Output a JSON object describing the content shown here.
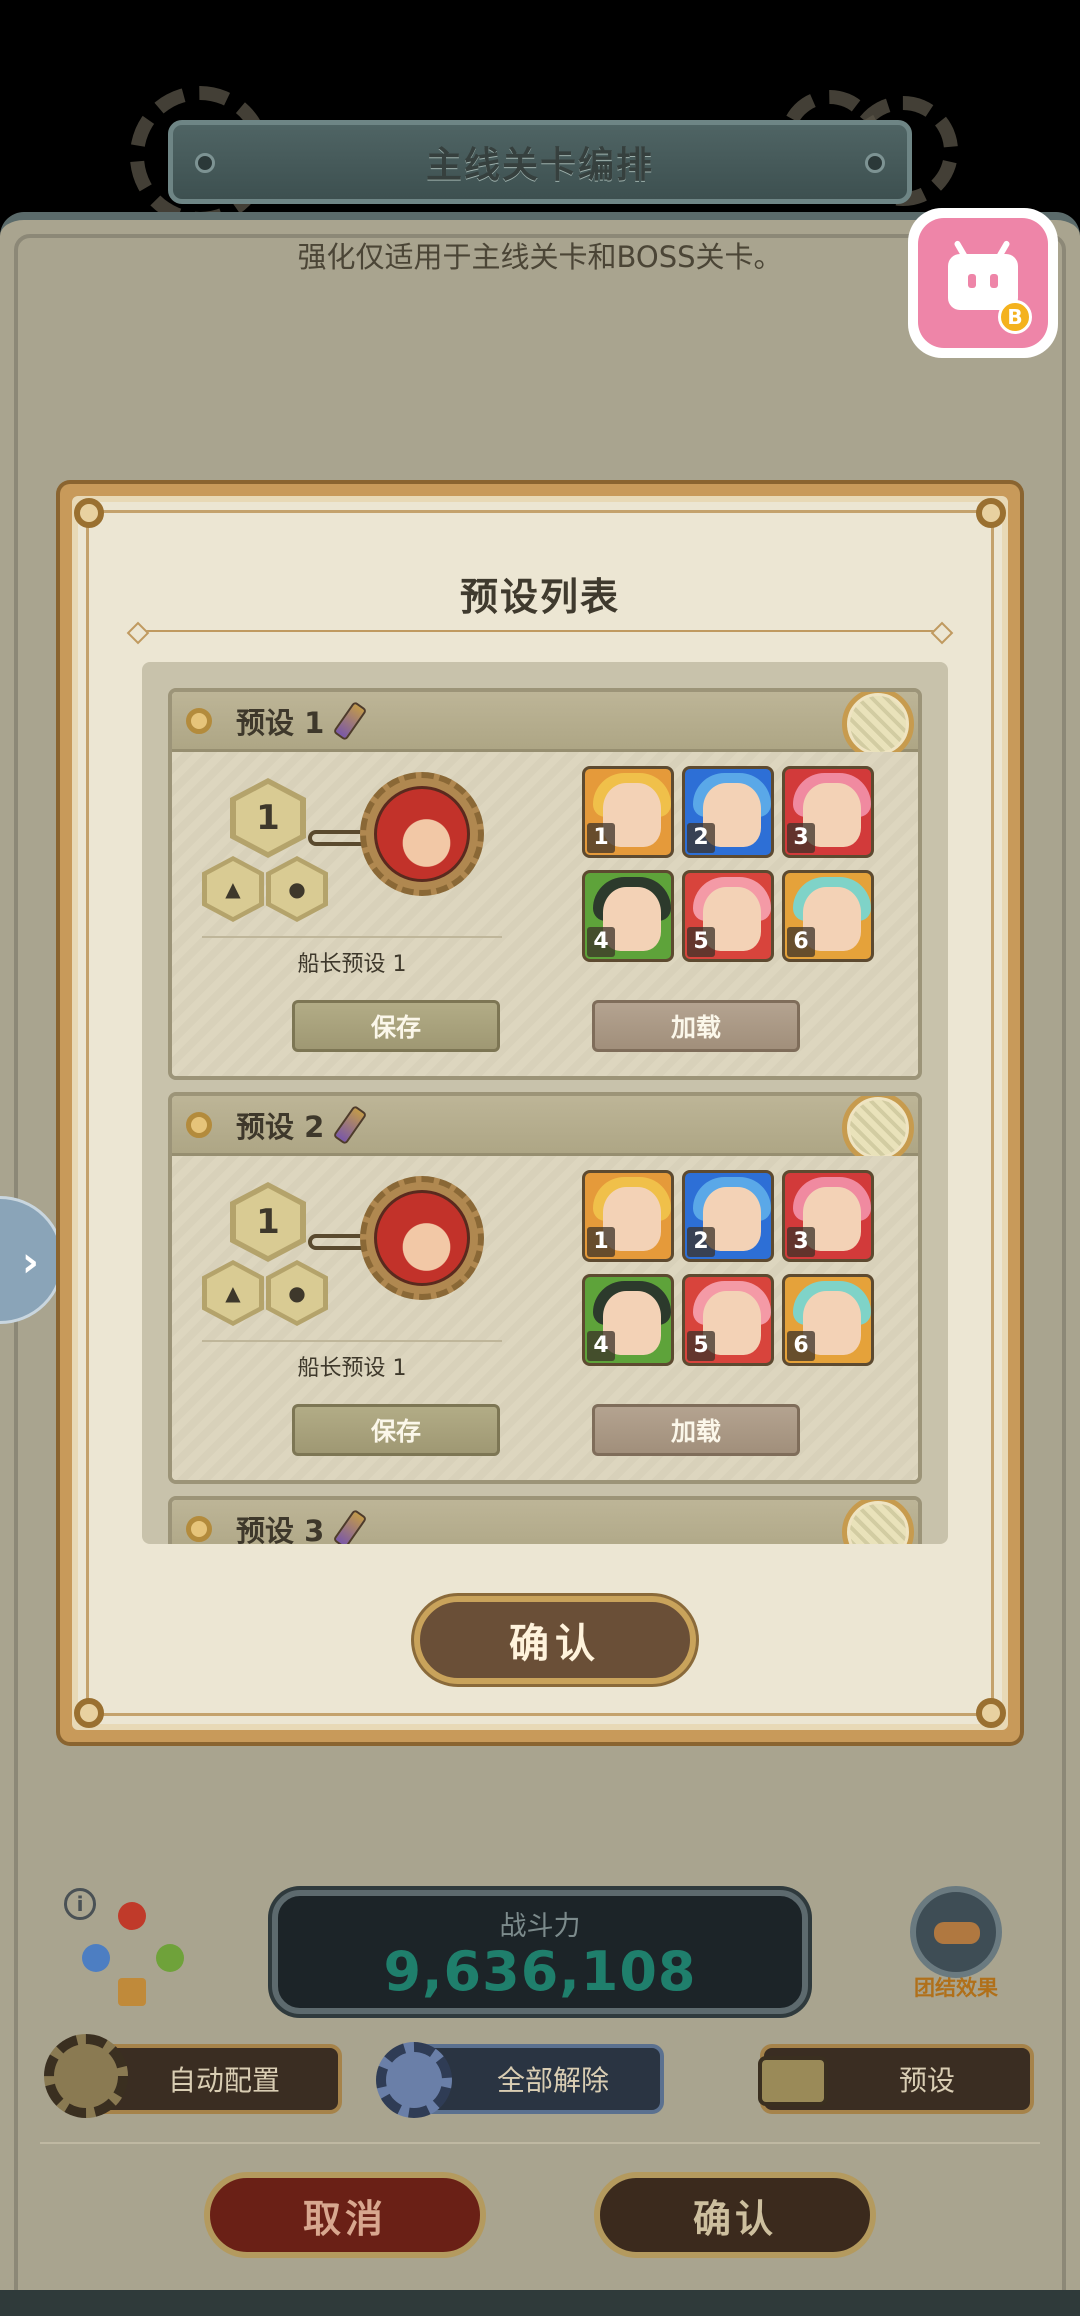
{
  "header": {
    "title": "主线关卡编排",
    "subtitle": "强化仅适用于主线关卡和BOSS关卡。"
  },
  "modal": {
    "title": "预设列表",
    "confirm_label": "确认",
    "presets": [
      {
        "name": "预设 1",
        "level": "1",
        "captain_label": "船长预设 1",
        "save_label": "保存",
        "load_label": "加载",
        "heroes": [
          "1",
          "2",
          "3",
          "4",
          "5",
          "6"
        ]
      },
      {
        "name": "预设 2",
        "level": "1",
        "captain_label": "船长预设 1",
        "save_label": "保存",
        "load_label": "加载",
        "heroes": [
          "1",
          "2",
          "3",
          "4",
          "5",
          "6"
        ]
      },
      {
        "name": "预设 3"
      }
    ]
  },
  "bottom": {
    "power_label": "战斗力",
    "power_value": "9,636,108",
    "union_label": "团结效果",
    "auto_label": "自动配置",
    "release_label": "全部解除",
    "preset_label": "预设",
    "cancel_label": "取消",
    "confirm_label": "确认"
  },
  "colors": {
    "power_value": "#1f7f6c",
    "modal_frame": "#c89a5a",
    "save_button": "#a9a27c",
    "load_button": "#ab9a86"
  }
}
